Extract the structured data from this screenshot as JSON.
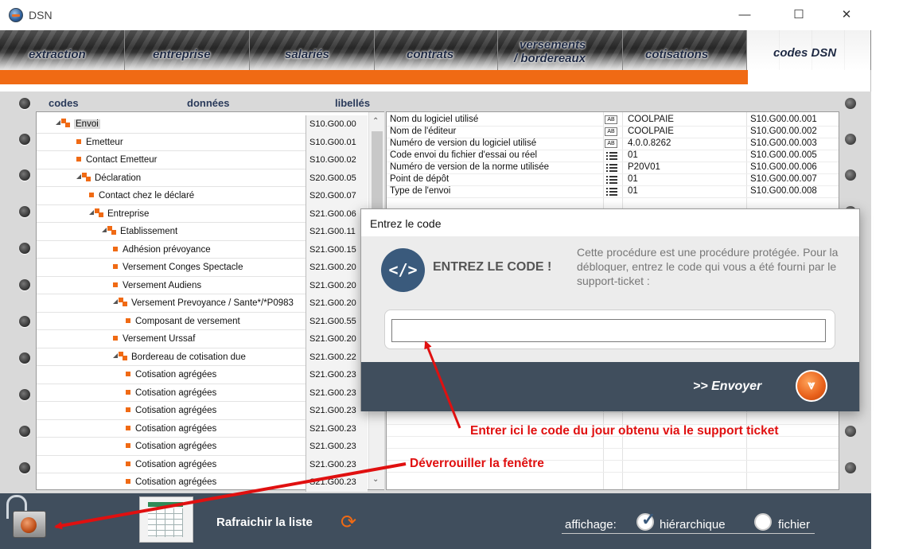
{
  "window": {
    "title": "DSN",
    "minimize": "—",
    "maximize": "☐",
    "close": "✕"
  },
  "tabs": [
    {
      "label": "extraction"
    },
    {
      "label": "entreprise"
    },
    {
      "label": "salariés"
    },
    {
      "label": "contrats"
    },
    {
      "label": "versements",
      "label2": "/ bordereaux"
    },
    {
      "label": "cotisations"
    },
    {
      "label": "codes DSN",
      "active": true
    }
  ],
  "columns": {
    "codes": "codes",
    "donnees": "données",
    "libelles": "libellés"
  },
  "tree": [
    {
      "label": "Envoi",
      "code": "S10.G00.00",
      "level": 1,
      "folder": true,
      "selected": true
    },
    {
      "label": "Emetteur",
      "code": "S10.G00.01",
      "level": 2,
      "folder": false
    },
    {
      "label": "Contact Emetteur",
      "code": "S10.G00.02",
      "level": 2,
      "folder": false
    },
    {
      "label": "Déclaration",
      "code": "S20.G00.05",
      "level": 2,
      "folder": true
    },
    {
      "label": "Contact chez le déclaré",
      "code": "S20.G00.07",
      "level": 3,
      "folder": false
    },
    {
      "label": "Entreprise",
      "code": "S21.G00.06",
      "level": 3,
      "folder": true
    },
    {
      "label": "Etablissement",
      "code": "S21.G00.11",
      "level": 4,
      "folder": true
    },
    {
      "label": "Adhésion prévoyance",
      "code": "S21.G00.15",
      "level": 5,
      "folder": false
    },
    {
      "label": "Versement Conges Spectacle",
      "code": "S21.G00.20",
      "level": 5,
      "folder": false
    },
    {
      "label": "Versement Audiens",
      "code": "S21.G00.20",
      "level": 5,
      "folder": false
    },
    {
      "label": "Versement Prevoyance / Sante*/*P0983",
      "code": "S21.G00.20",
      "level": 5,
      "folder": true
    },
    {
      "label": "Composant de versement",
      "code": "S21.G00.55",
      "level": 6,
      "folder": false
    },
    {
      "label": "Versement Urssaf",
      "code": "S21.G00.20",
      "level": 5,
      "folder": false
    },
    {
      "label": "Bordereau de cotisation due",
      "code": "S21.G00.22",
      "level": 5,
      "folder": true
    },
    {
      "label": "Cotisation agrégées",
      "code": "S21.G00.23",
      "level": 6,
      "folder": false
    },
    {
      "label": "Cotisation agrégées",
      "code": "S21.G00.23",
      "level": 6,
      "folder": false
    },
    {
      "label": "Cotisation agrégées",
      "code": "S21.G00.23",
      "level": 6,
      "folder": false
    },
    {
      "label": "Cotisation agrégées",
      "code": "S21.G00.23",
      "level": 6,
      "folder": false
    },
    {
      "label": "Cotisation agrégées",
      "code": "S21.G00.23",
      "level": 6,
      "folder": false
    },
    {
      "label": "Cotisation agrégées",
      "code": "S21.G00.23",
      "level": 6,
      "folder": false
    },
    {
      "label": "Cotisation agrégées",
      "code": "S21.G00.23",
      "level": 6,
      "folder": false
    }
  ],
  "properties": [
    {
      "name": "Nom du logiciel utilisé",
      "type": "text",
      "type_label": "AB",
      "value": "COOLPAIE",
      "code": "S10.G00.00.001"
    },
    {
      "name": "Nom de l'éditeur",
      "type": "text",
      "type_label": "AB",
      "value": "COOLPAIE",
      "code": "S10.G00.00.002"
    },
    {
      "name": "Numéro de version du logiciel utilisé",
      "type": "text",
      "type_label": "AB",
      "value": "4.0.0.8262",
      "code": "S10.G00.00.003"
    },
    {
      "name": "Code envoi du fichier d'essai ou réel",
      "type": "list",
      "value": "01",
      "code": "S10.G00.00.005"
    },
    {
      "name": "Numéro de version de la norme utilisée",
      "type": "list",
      "value": "P20V01",
      "code": "S10.G00.00.006"
    },
    {
      "name": "Point de dépôt",
      "type": "list",
      "value": "01",
      "code": "S10.G00.00.007"
    },
    {
      "name": "Type de l'envoi",
      "type": "list",
      "value": "01",
      "code": "S10.G00.00.008"
    }
  ],
  "dialog": {
    "title": "Entrez le code",
    "icon": "code-icon",
    "icon_glyph": "</>",
    "heading": "ENTREZ LE CODE !",
    "message": "Cette procédure est une procédure protégée. Pour la débloquer, entrez le code qui vous a été fourni par le support-ticket :",
    "input_value": "",
    "send_label": ">> Envoyer",
    "send_glyph": "⩔"
  },
  "bottom": {
    "refresh_label": "Rafraichir la liste",
    "refresh_glyph": "⟳",
    "affichage_label": "affichage:",
    "option_hier": "hiérarchique",
    "option_fichier": "fichier",
    "check_glyph": "✓"
  },
  "annotations": {
    "code_hint": "Entrer ici le code du jour obtenu via le support ticket",
    "unlock_hint": "Déverrouiller la fenêtre"
  },
  "colors": {
    "accent": "#f06a14",
    "dark": "#404e5d",
    "annotation": "#e01010"
  }
}
